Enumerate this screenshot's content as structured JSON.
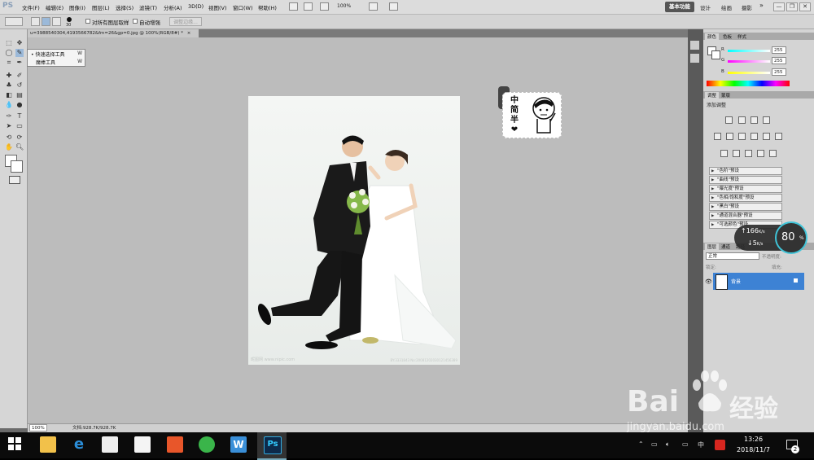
{
  "app": {
    "logo": "PS"
  },
  "menu": [
    "文件(F)",
    "编辑(E)",
    "图像(I)",
    "图层(L)",
    "选择(S)",
    "滤镜(T)",
    "分析(A)",
    "3D(D)",
    "视图(V)",
    "窗口(W)",
    "帮助(H)"
  ],
  "zoom": "100%",
  "workspaces": {
    "active": "基本功能",
    "others": [
      "设计",
      "绘画",
      "摄影"
    ],
    "more": "»"
  },
  "window_buttons": {
    "minimize": "—",
    "restore": "❐",
    "close": "✕"
  },
  "options": {
    "brush_size": "30",
    "sample_all_layers": "对所有图层取样",
    "auto_enhance": "自动增强",
    "refine_edge": "调整边缘..."
  },
  "document": {
    "tab_title": "u=3988540304,4193566782&fm=26&gp=0.jpg @ 100%(RGB/8#) *",
    "close": "×",
    "status_zoom": "100%",
    "doc_info": "文档:928.7K/928.7K"
  },
  "flyout": {
    "items": [
      {
        "label": "快速选择工具",
        "key": "W"
      },
      {
        "label": "魔棒工具",
        "key": "W"
      }
    ]
  },
  "sticker": {
    "chars": [
      "中",
      "简",
      "半",
      "❤"
    ]
  },
  "color_panel": {
    "tabs": [
      "颜色",
      "色板",
      "样式"
    ],
    "channels": [
      {
        "label": "R",
        "value": "255",
        "color": "#e04040"
      },
      {
        "label": "G",
        "value": "255",
        "color": "#40c040"
      },
      {
        "label": "B",
        "value": "255",
        "color": "#e0d040"
      }
    ]
  },
  "adjust_panel": {
    "tabs": [
      "调整",
      "蒙版"
    ],
    "title": "添加调整",
    "presets": [
      "\"色阶\"预设",
      "\"曲线\"预设",
      "\"曝光度\"预设",
      "\"色相/饱和度\"预设",
      "\"黑白\"预设",
      "\"通道混合器\"预设",
      "\"可选颜色\"预设"
    ]
  },
  "layers_panel": {
    "tabs": [
      "图层",
      "通道",
      "路径"
    ],
    "blend_mode": "正常",
    "opacity_label": "不透明度:",
    "lock_label": "锁定:",
    "fill_label": "填充:",
    "layer_name": "背景"
  },
  "speed_widget": {
    "upload": "166",
    "upload_unit": "K/s",
    "download": "5",
    "download_unit": "K/s",
    "percent": "80",
    "percent_unit": "%"
  },
  "watermark": {
    "brand": "Bai",
    "brand_cn": "经验",
    "url": "jingyan.baidu.com"
  },
  "photo_watermark": {
    "left": "昵图网 www.nipic.com",
    "right": "BY:3331843 No:20081202030121456389"
  },
  "taskbar": {
    "time": "13:26",
    "date": "2018/11/7",
    "ime": "中",
    "notifications": "2",
    "apps": [
      "start-icon",
      "file-explorer-icon",
      "edge-icon",
      "store-icon",
      "mail-icon",
      "wps-slides-icon",
      "wechat-icon",
      "wps-writer-icon",
      "photoshop-icon"
    ],
    "photoshop_label": "Ps",
    "wps_label": "W"
  }
}
